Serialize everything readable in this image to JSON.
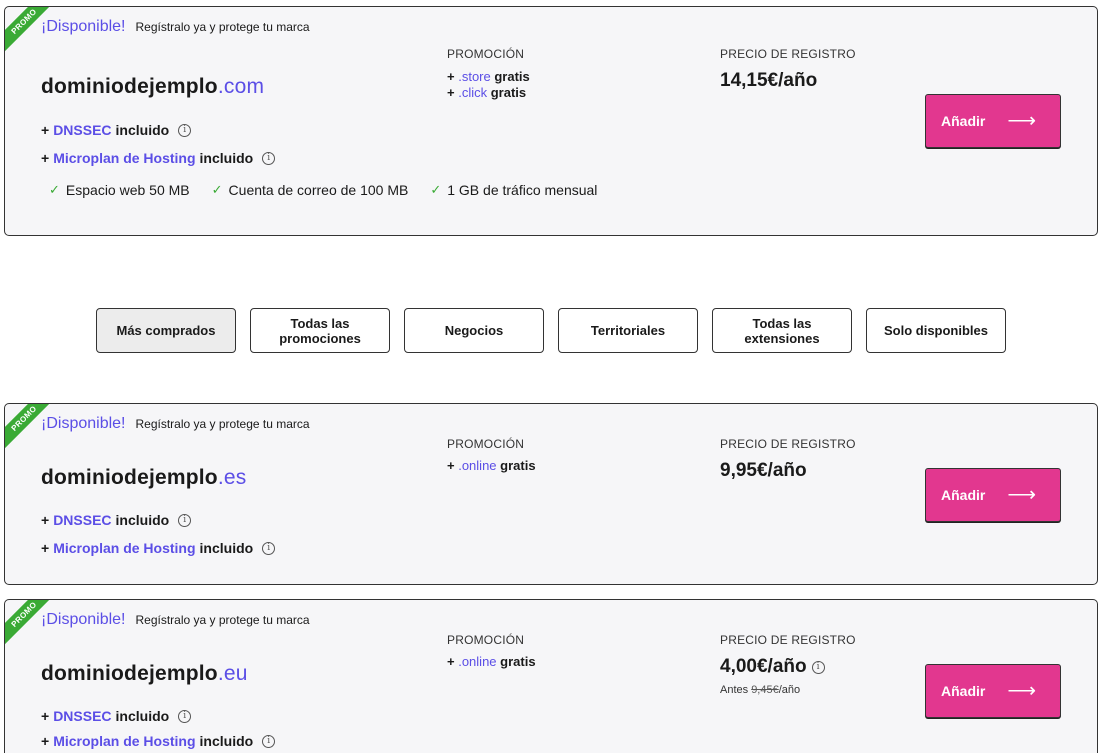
{
  "colors": {
    "accent": "#5b4ee6",
    "button": "#e2378f",
    "promo": "#3aaa35"
  },
  "cards": [
    {
      "promo": "PROMO",
      "available": "¡Disponible!",
      "available_sub": "Regístralo ya y protege tu marca",
      "domain_name": "dominiodejemplo",
      "tld": ".com",
      "features": [
        {
          "prefix": "+ ",
          "highlight": "DNSSEC",
          "suffix": " incluido"
        },
        {
          "prefix": "+ ",
          "highlight": "Microplan de Hosting",
          "suffix": " incluido"
        }
      ],
      "checks": [
        "Espacio web 50 MB",
        "Cuenta de correo de 100 MB",
        "1 GB de tráfico mensual"
      ],
      "promo_label": "PROMOCIÓN",
      "promo_items": [
        {
          "prefix": "+ ",
          "tld": ".store",
          "suffix": " gratis"
        },
        {
          "prefix": "+ ",
          "tld": ".click",
          "suffix": " gratis"
        }
      ],
      "price_label": "PRECIO DE REGISTRO",
      "price": "14,15€/año",
      "button": "Añadir"
    },
    {
      "promo": "PROMO",
      "available": "¡Disponible!",
      "available_sub": "Regístralo ya y protege tu marca",
      "domain_name": "dominiodejemplo",
      "tld": ".es",
      "features": [
        {
          "prefix": "+ ",
          "highlight": "DNSSEC",
          "suffix": " incluido"
        },
        {
          "prefix": "+ ",
          "highlight": "Microplan de Hosting",
          "suffix": " incluido"
        }
      ],
      "promo_label": "PROMOCIÓN",
      "promo_items": [
        {
          "prefix": "+ ",
          "tld": ".online",
          "suffix": " gratis"
        }
      ],
      "price_label": "PRECIO DE REGISTRO",
      "price": "9,95€/año",
      "button": "Añadir"
    },
    {
      "promo": "PROMO",
      "available": "¡Disponible!",
      "available_sub": "Regístralo ya y protege tu marca",
      "domain_name": "dominiodejemplo",
      "tld": ".eu",
      "features": [
        {
          "prefix": "+ ",
          "highlight": "DNSSEC",
          "suffix": " incluido"
        },
        {
          "prefix": "+ ",
          "highlight": "Microplan de Hosting",
          "suffix": " incluido"
        }
      ],
      "promo_label": "PROMOCIÓN",
      "promo_items": [
        {
          "prefix": "+ ",
          "tld": ".online",
          "suffix": " gratis"
        }
      ],
      "price_label": "PRECIO DE REGISTRO",
      "price": "4,00€/año",
      "before_label": "Antes ",
      "before_price": "9,45€",
      "before_suffix": "/año",
      "button": "Añadir"
    }
  ],
  "filters": [
    "Más comprados",
    "Todas las promociones",
    "Negocios",
    "Territoriales",
    "Todas las extensiones",
    "Solo disponibles"
  ]
}
